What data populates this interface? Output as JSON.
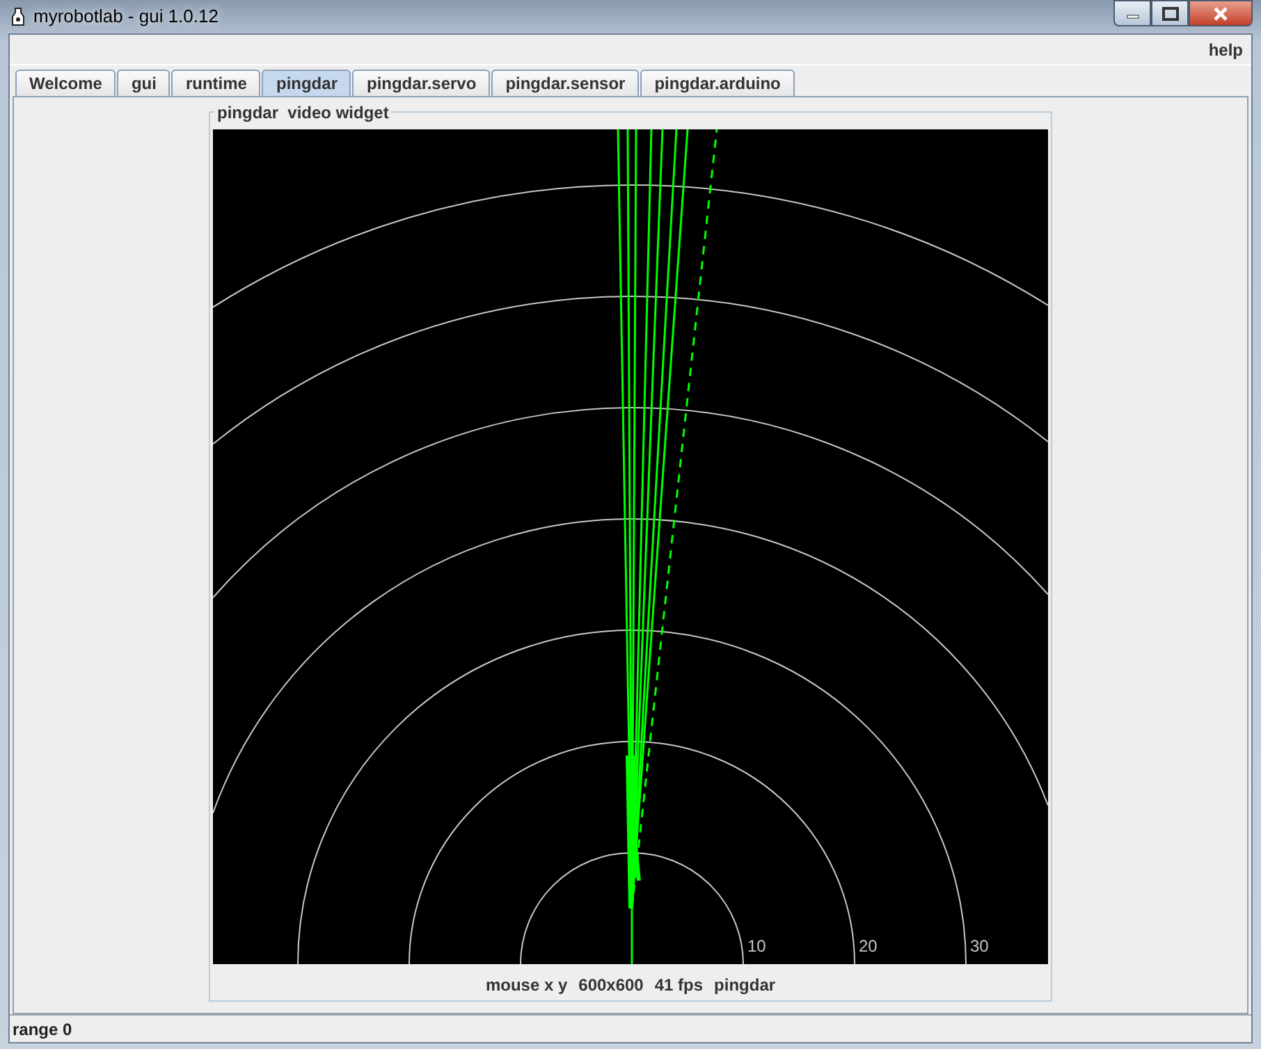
{
  "window": {
    "title": "myrobotlab - gui 1.0.12"
  },
  "menu": [
    "help"
  ],
  "tabs": [
    {
      "label": "Welcome",
      "selected": false
    },
    {
      "label": "gui",
      "selected": false
    },
    {
      "label": "runtime",
      "selected": false
    },
    {
      "label": "pingdar",
      "selected": true
    },
    {
      "label": "pingdar.servo",
      "selected": false
    },
    {
      "label": "pingdar.sensor",
      "selected": false
    },
    {
      "label": "pingdar.arduino",
      "selected": false
    }
  ],
  "widget": {
    "title": "pingdar  video widget",
    "range_labels": [
      "10",
      "20",
      "30"
    ],
    "status": [
      "mouse x y",
      "600x600",
      "41 fps",
      "pingdar"
    ]
  },
  "status_bar": "range 0"
}
